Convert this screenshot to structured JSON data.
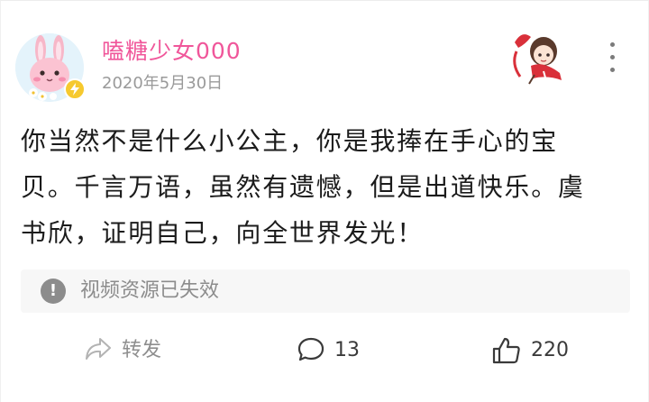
{
  "post": {
    "username": "嗑糖少女000",
    "date": "2020年5月30日",
    "lines": [
      "你当然不是什么小公主，你是我捧在手心的宝",
      "贝。千言万语，虽然有遗憾，但是出道快乐。虞",
      "书欣，证明自己，向全世界发光！"
    ],
    "notice": {
      "icon": "!",
      "text": "视频资源已失效"
    }
  },
  "actions": {
    "forward_label": "转发",
    "comments_count": "13",
    "likes_count": "220"
  },
  "icons": {
    "avatar": "pink-bunny-avatar-icon",
    "badge": "lightning-badge-icon",
    "corner": "anime-girl-sticker-icon",
    "more": "vertical-ellipsis-icon",
    "forward": "forward-arrow-icon",
    "comment": "comment-bubble-icon",
    "like": "thumbs-up-icon"
  },
  "colors": {
    "username": "#f0569a",
    "badge": "#f6c92e",
    "avatar_bg": "#e4f3fb",
    "notice_bg": "#f7f7f7"
  }
}
